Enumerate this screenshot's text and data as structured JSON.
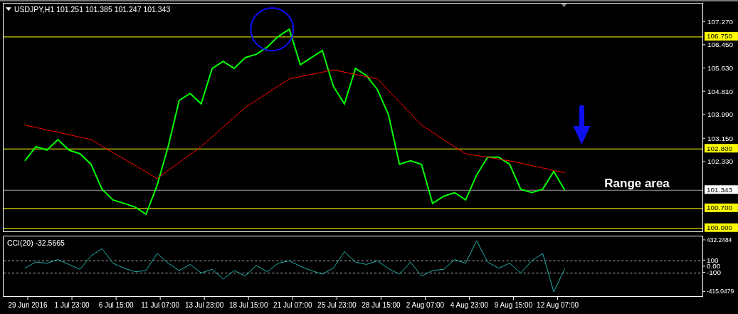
{
  "header": {
    "symbol": "USDJPY,H1",
    "quotes": [
      "101.251",
      "101.385",
      "101.247",
      "101.343"
    ]
  },
  "price_chart": {
    "chart_data": {
      "type": "line",
      "ylim": [
        99.9,
        107.92
      ],
      "yticks": [
        {
          "value": 107.27,
          "label": "107.270"
        },
        {
          "value": 106.45,
          "label": "106.450"
        },
        {
          "value": 105.63,
          "label": "105.630"
        },
        {
          "value": 104.81,
          "label": "104.810"
        },
        {
          "value": 103.99,
          "label": "103.990"
        },
        {
          "value": 103.15,
          "label": "103.150"
        },
        {
          "value": 102.33,
          "label": "102.330"
        }
      ],
      "series": [
        {
          "color": "#00ff00",
          "values": [
            102.38,
            102.88,
            102.76,
            103.13,
            102.76,
            102.63,
            102.26,
            101.38,
            101.0,
            100.88,
            100.75,
            100.5,
            101.51,
            102.88,
            104.51,
            104.76,
            104.39,
            105.64,
            105.89,
            105.64,
            106.02,
            106.14,
            106.39,
            106.77,
            107.02,
            105.77,
            106.02,
            106.27,
            105.01,
            104.39,
            105.64,
            105.39,
            104.89,
            104.01,
            102.26,
            102.38,
            102.26,
            100.88,
            101.13,
            101.26,
            101.0,
            101.88,
            102.51,
            102.51,
            102.26,
            101.38,
            101.26,
            101.38,
            102.01,
            101.34,
            null,
            null,
            null,
            null,
            null,
            null,
            null,
            null,
            null,
            null,
            null,
            null
          ]
        },
        {
          "color": "#ff0000",
          "values": [
            103.64,
            103.56,
            103.47,
            103.39,
            103.3,
            103.22,
            103.13,
            102.9,
            102.67,
            102.45,
            102.22,
            101.99,
            101.76,
            102.04,
            102.32,
            102.6,
            102.88,
            103.23,
            103.57,
            103.92,
            104.26,
            104.51,
            104.77,
            105.02,
            105.27,
            105.35,
            105.43,
            105.51,
            105.59,
            105.51,
            105.43,
            105.35,
            105.27,
            104.86,
            104.46,
            104.05,
            103.64,
            103.39,
            103.13,
            102.88,
            102.63,
            102.57,
            102.51,
            102.44,
            102.38,
            102.3,
            102.21,
            102.13,
            102.04,
            101.96,
            null,
            null,
            null,
            null,
            null,
            null,
            null,
            null,
            null,
            null,
            null,
            null
          ]
        }
      ],
      "ref_lines": [
        {
          "axis": "y",
          "value": 106.75,
          "label": "106.750",
          "color": "#ffff00"
        },
        {
          "axis": "y",
          "value": 102.8,
          "label": "102.800",
          "color": "#ffff00"
        },
        {
          "axis": "y",
          "value": 101.343,
          "label": "101.343",
          "color": "#a0a0a0"
        },
        {
          "axis": "y",
          "value": 100.7,
          "label": "100.700",
          "color": "#ffff00"
        },
        {
          "axis": "y",
          "value": 100.0,
          "label": "100.000",
          "color": "#ffff00"
        }
      ],
      "annotations": [
        "Range area"
      ]
    }
  },
  "indicator": {
    "label": "CCI(20) -32.5665",
    "chart_data": {
      "type": "line",
      "ylim": [
        -480,
        500
      ],
      "categories": [
        "29 Jun 2016",
        null,
        null,
        null,
        "1 Jul 23:00",
        null,
        null,
        null,
        "6 Jul 15:00",
        null,
        null,
        null,
        "11 Jul 07:00",
        null,
        null,
        null,
        "13 Jul 23:00",
        null,
        null,
        null,
        "18 Jul 15:00",
        null,
        null,
        null,
        "21 Jul 07:00",
        null,
        null,
        null,
        "25 Jul 23:00",
        null,
        null,
        null,
        "28 Jul 15:00",
        null,
        null,
        null,
        "2 Aug 07:00",
        null,
        null,
        null,
        "4 Aug 23:00",
        null,
        null,
        null,
        "9 Aug 15:00",
        null,
        null,
        null,
        "12 Aug 07:00",
        null,
        null,
        null,
        null,
        null,
        null,
        null,
        null,
        null,
        null,
        null,
        null,
        null
      ],
      "yticks": [
        {
          "value": 432.2484,
          "label": "432.2484"
        },
        {
          "value": 100,
          "label": "100"
        },
        {
          "value": 0,
          "label": "0.00"
        },
        {
          "value": -100,
          "label": "-100"
        },
        {
          "value": -415.0479,
          "label": "-415.0479"
        }
      ],
      "series": [
        {
          "color": "#20b2aa",
          "values": [
            -20,
            80,
            60,
            120,
            40,
            -40,
            180,
            300,
            60,
            -20,
            -80,
            -60,
            220,
            60,
            -60,
            40,
            -100,
            -40,
            -200,
            -60,
            -150,
            20,
            -80,
            60,
            100,
            10,
            -60,
            -120,
            -20,
            250,
            80,
            40,
            100,
            -30,
            -120,
            80,
            -150,
            -60,
            -40,
            120,
            60,
            430,
            80,
            -20,
            60,
            -100,
            100,
            220,
            -410,
            -30,
            null,
            null,
            null,
            null,
            null,
            null,
            null,
            null,
            null,
            null,
            null,
            null
          ]
        }
      ],
      "ref_lines": [
        {
          "axis": "y",
          "value": 100
        },
        {
          "axis": "y",
          "value": -100
        }
      ]
    }
  }
}
